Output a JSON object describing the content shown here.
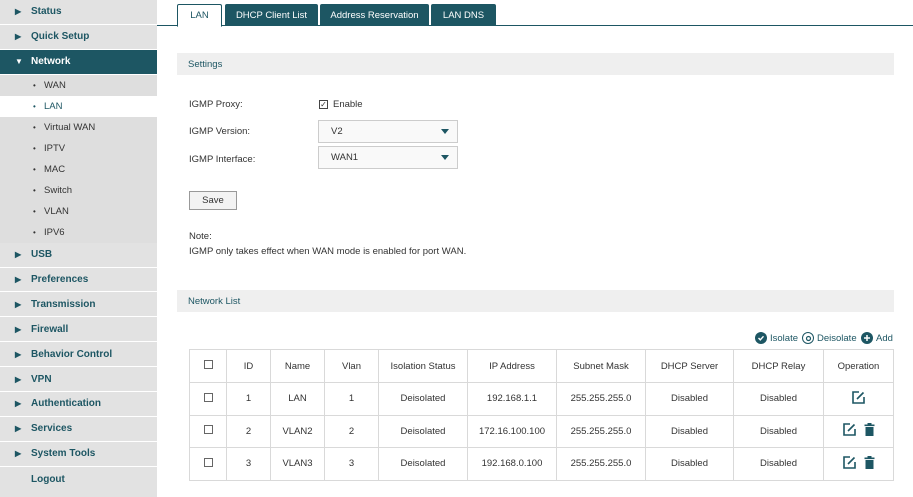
{
  "sidebar": {
    "items": [
      {
        "label": "Status"
      },
      {
        "label": "Quick Setup"
      },
      {
        "label": "Network"
      },
      {
        "label": "USB"
      },
      {
        "label": "Preferences"
      },
      {
        "label": "Transmission"
      },
      {
        "label": "Firewall"
      },
      {
        "label": "Behavior Control"
      },
      {
        "label": "VPN"
      },
      {
        "label": "Authentication"
      },
      {
        "label": "Services"
      },
      {
        "label": "System Tools"
      },
      {
        "label": "Logout"
      }
    ],
    "network_sub": [
      {
        "label": "WAN"
      },
      {
        "label": "LAN"
      },
      {
        "label": "Virtual WAN"
      },
      {
        "label": "IPTV"
      },
      {
        "label": "MAC"
      },
      {
        "label": "Switch"
      },
      {
        "label": "VLAN"
      },
      {
        "label": "IPV6"
      }
    ]
  },
  "tabs": [
    {
      "label": "LAN"
    },
    {
      "label": "DHCP Client List"
    },
    {
      "label": "Address Reservation"
    },
    {
      "label": "LAN DNS"
    }
  ],
  "settings": {
    "header": "Settings",
    "igmp_proxy_label": "IGMP Proxy:",
    "enable_label": "Enable",
    "igmp_version_label": "IGMP Version:",
    "igmp_version_value": "V2",
    "igmp_interface_label": "IGMP Interface:",
    "igmp_interface_value": "WAN1",
    "save_label": "Save",
    "note_title": "Note:",
    "note_text": "IGMP only takes effect when WAN mode is enabled for port WAN."
  },
  "network_list": {
    "header": "Network List",
    "isolate_label": "Isolate",
    "deisolate_label": "Deisolate",
    "add_label": "Add",
    "columns": [
      "ID",
      "Name",
      "Vlan",
      "Isolation Status",
      "IP Address",
      "Subnet Mask",
      "DHCP Server",
      "DHCP Relay",
      "Operation"
    ],
    "rows": [
      {
        "id": "1",
        "name": "LAN",
        "vlan": "1",
        "isolation": "Deisolated",
        "ip": "192.168.1.1",
        "mask": "255.255.255.0",
        "dhcp_server": "Disabled",
        "dhcp_relay": "Disabled"
      },
      {
        "id": "2",
        "name": "VLAN2",
        "vlan": "2",
        "isolation": "Deisolated",
        "ip": "172.16.100.100",
        "mask": "255.255.255.0",
        "dhcp_server": "Disabled",
        "dhcp_relay": "Disabled"
      },
      {
        "id": "3",
        "name": "VLAN3",
        "vlan": "3",
        "isolation": "Deisolated",
        "ip": "192.168.0.100",
        "mask": "255.255.255.0",
        "dhcp_server": "Disabled",
        "dhcp_relay": "Disabled"
      }
    ]
  },
  "colors": {
    "accent": "#1d5663",
    "sidebar_bg": "#e2e2e2",
    "section_bg": "#efefef"
  }
}
